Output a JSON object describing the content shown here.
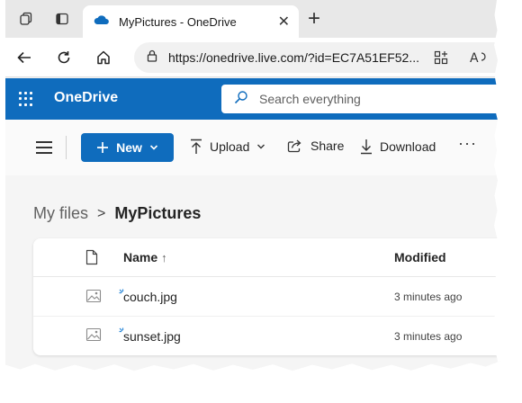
{
  "browser": {
    "tab_title": "MyPictures - OneDrive",
    "tab_close": "✕",
    "new_tab": "+",
    "address": "https://onedrive.live.com/?id=EC7A51EF52..."
  },
  "app": {
    "brand": "OneDrive",
    "search_placeholder": "Search everything"
  },
  "commands": {
    "new_label": "New",
    "upload_label": "Upload",
    "share_label": "Share",
    "download_label": "Download",
    "more_label": "···"
  },
  "breadcrumb": {
    "root": "My files",
    "separator": ">",
    "current": "MyPictures"
  },
  "file_list": {
    "columns": {
      "name": "Name",
      "sort_arrow": "↑",
      "modified": "Modified"
    },
    "rows": [
      {
        "name": "couch.jpg",
        "modified": "3 minutes ago"
      },
      {
        "name": "sunset.jpg",
        "modified": "3 minutes ago"
      }
    ]
  },
  "icons": {
    "tab_actions": "tab-actions-icon",
    "vertical_tabs": "vertical-tabs-icon",
    "onedrive_cloud": "cloud-icon",
    "back": "back-arrow-icon",
    "refresh": "refresh-icon",
    "home": "home-icon",
    "lock": "lock-icon",
    "apps": "apps-icon",
    "read_aloud": "read-aloud-icon",
    "waffle": "app-launcher-icon",
    "search": "search-icon",
    "hamburger": "menu-icon",
    "plus": "plus-icon",
    "upload": "upload-icon",
    "share": "share-icon",
    "download": "download-icon",
    "file_type": "file-icon",
    "image": "image-file-icon"
  },
  "colors": {
    "brand_blue": "#0f6cbd",
    "new_badge": "#2b88d8"
  }
}
